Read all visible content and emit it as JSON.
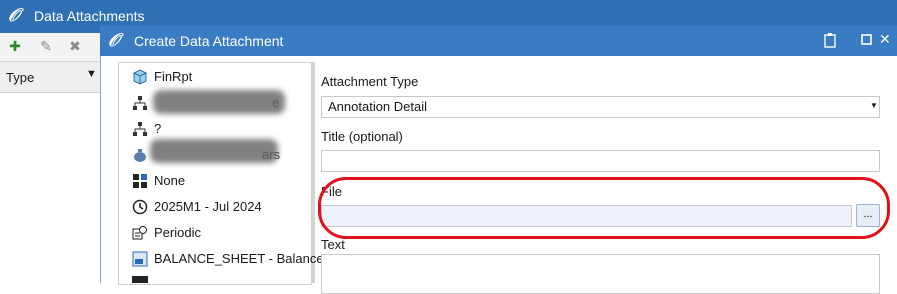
{
  "background_window": {
    "title": "Data Attachments",
    "column_header": "Type",
    "toolbar_icons": [
      "new-icon",
      "edit-icon",
      "delete-icon"
    ]
  },
  "dialog": {
    "title": "Create Data Attachment",
    "title_controls": [
      "clipboard-icon",
      "maximize-icon",
      "close-icon"
    ],
    "tree": {
      "items": [
        {
          "label": "FinRpt",
          "icon": "cube-icon"
        },
        {
          "label": "e",
          "icon": "hierarchy-icon"
        },
        {
          "label": "?",
          "icon": "hierarchy-icon"
        },
        {
          "label": "ars",
          "icon": "money-bag-icon"
        },
        {
          "label": "None",
          "icon": "grid-icon"
        },
        {
          "label": "2025M1 - Jul 2024",
          "icon": "clock-icon"
        },
        {
          "label": "Periodic",
          "icon": "view-icon"
        },
        {
          "label": "BALANCE_SHEET - Balance",
          "icon": "account-icon"
        }
      ]
    },
    "form": {
      "attachment_type_label": "Attachment Type",
      "attachment_type_value": "Annotation Detail",
      "title_label": "Title (optional)",
      "title_value": "",
      "file_label": "File",
      "file_value": "",
      "browse_label": "...",
      "text_label": "Text",
      "text_value": ""
    },
    "highlight_color": "#e0111b"
  }
}
